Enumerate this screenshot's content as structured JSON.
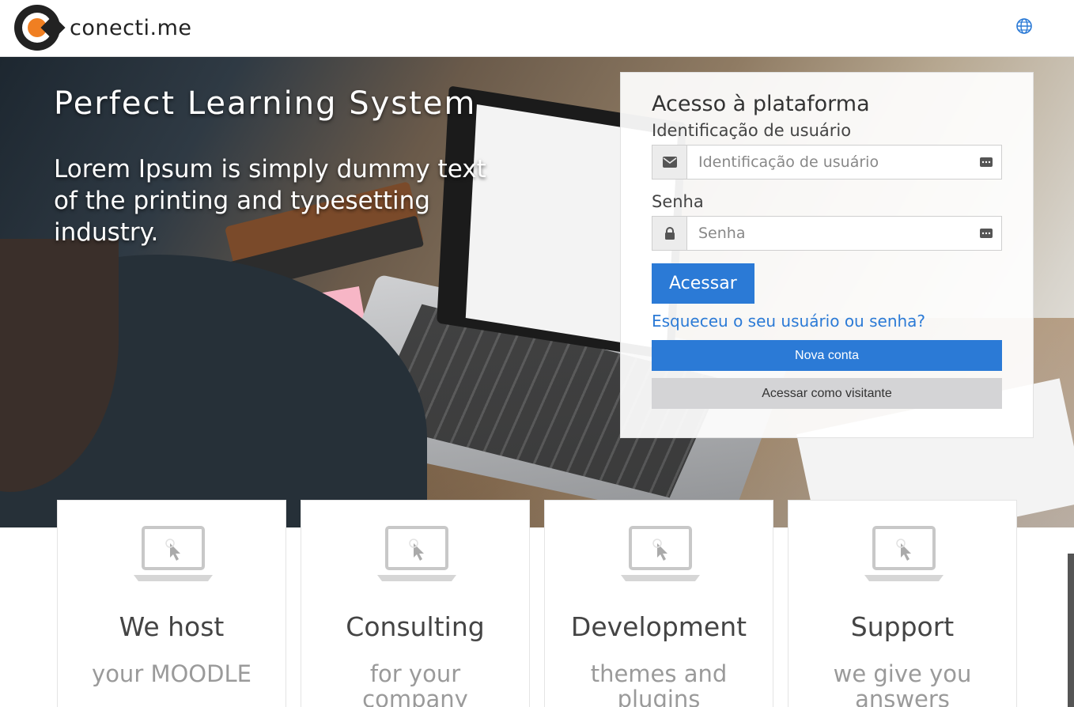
{
  "header": {
    "brand_name": "conecti.me",
    "logo_icon": "conectime-logo",
    "language_icon": "globe-icon"
  },
  "hero": {
    "title": "Perfect Learning System",
    "subtitle": "Lorem Ipsum is simply dummy text of the printing and typesetting industry."
  },
  "login": {
    "heading": "Acesso à plataforma",
    "username_label": "Identificação de usuário",
    "username_placeholder": "Identificação de usuário",
    "username_icon": "envelope-icon",
    "password_label": "Senha",
    "password_placeholder": "Senha",
    "password_icon": "lock-icon",
    "submit_label": "Acessar",
    "forgot_link": "Esqueceu o seu usuário ou senha?",
    "new_account_label": "Nova conta",
    "guest_label": "Acessar como visitante"
  },
  "features": [
    {
      "title": "We host",
      "subtitle": "your MOODLE",
      "icon": "laptop-cursor-icon"
    },
    {
      "title": "Consulting",
      "subtitle": "for your company",
      "icon": "laptop-cursor-icon"
    },
    {
      "title": "Development",
      "subtitle": "themes and plugins",
      "icon": "laptop-cursor-icon"
    },
    {
      "title": "Support",
      "subtitle": "we give you answers",
      "icon": "laptop-cursor-icon"
    }
  ],
  "colors": {
    "primary": "#2b7ad6",
    "brand_orange": "#f07f22",
    "guest_button": "#d4d4d6"
  }
}
